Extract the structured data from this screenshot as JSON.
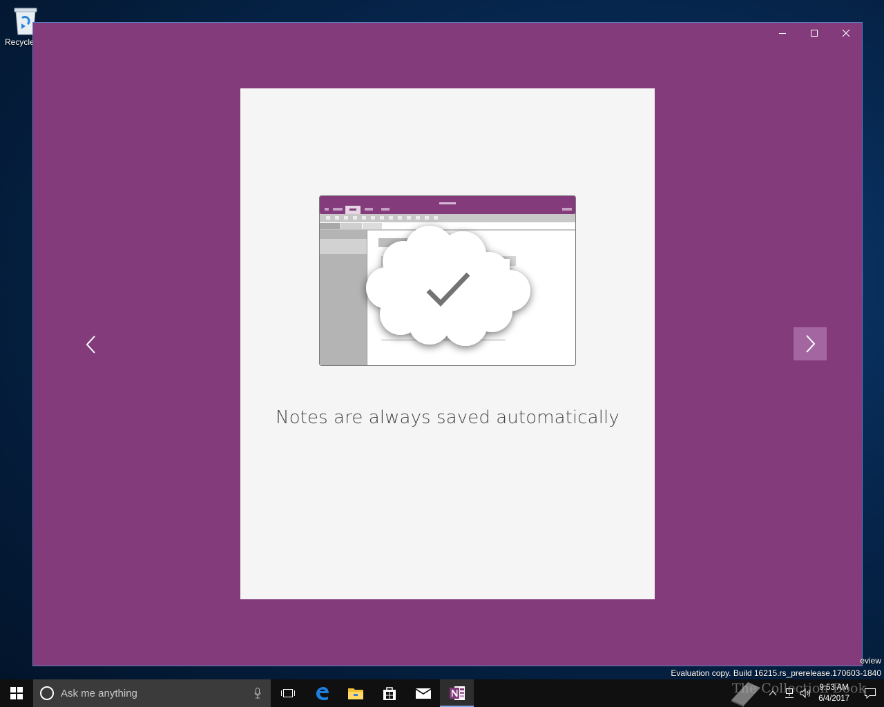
{
  "desktop": {
    "recycle_bin_label": "Recycle"
  },
  "watermark": {
    "line1": "eview",
    "line2": "Evaluation copy. Build 16215.rs_prerelease.170603-1840"
  },
  "window": {
    "background_color": "#833b7c",
    "caption_buttons": [
      "minimize-icon",
      "maximize-icon",
      "close-icon"
    ]
  },
  "onboarding": {
    "caption": "Notes are always saved automatically",
    "illustration": "onenote-cloud-saved-illustration",
    "prev_icon": "chevron-left-icon",
    "next_icon": "chevron-right-icon",
    "next_button_color": "#a466a0"
  },
  "taskbar": {
    "search_placeholder": "Ask me anything",
    "apps": [
      "task-view-icon",
      "edge-icon",
      "file-explorer-icon",
      "store-icon",
      "mail-icon",
      "onenote-icon"
    ],
    "active_app": "onenote-icon",
    "tray_overlay": "The Collection Book",
    "time": "9:53 AM",
    "date": "6/4/2017"
  }
}
